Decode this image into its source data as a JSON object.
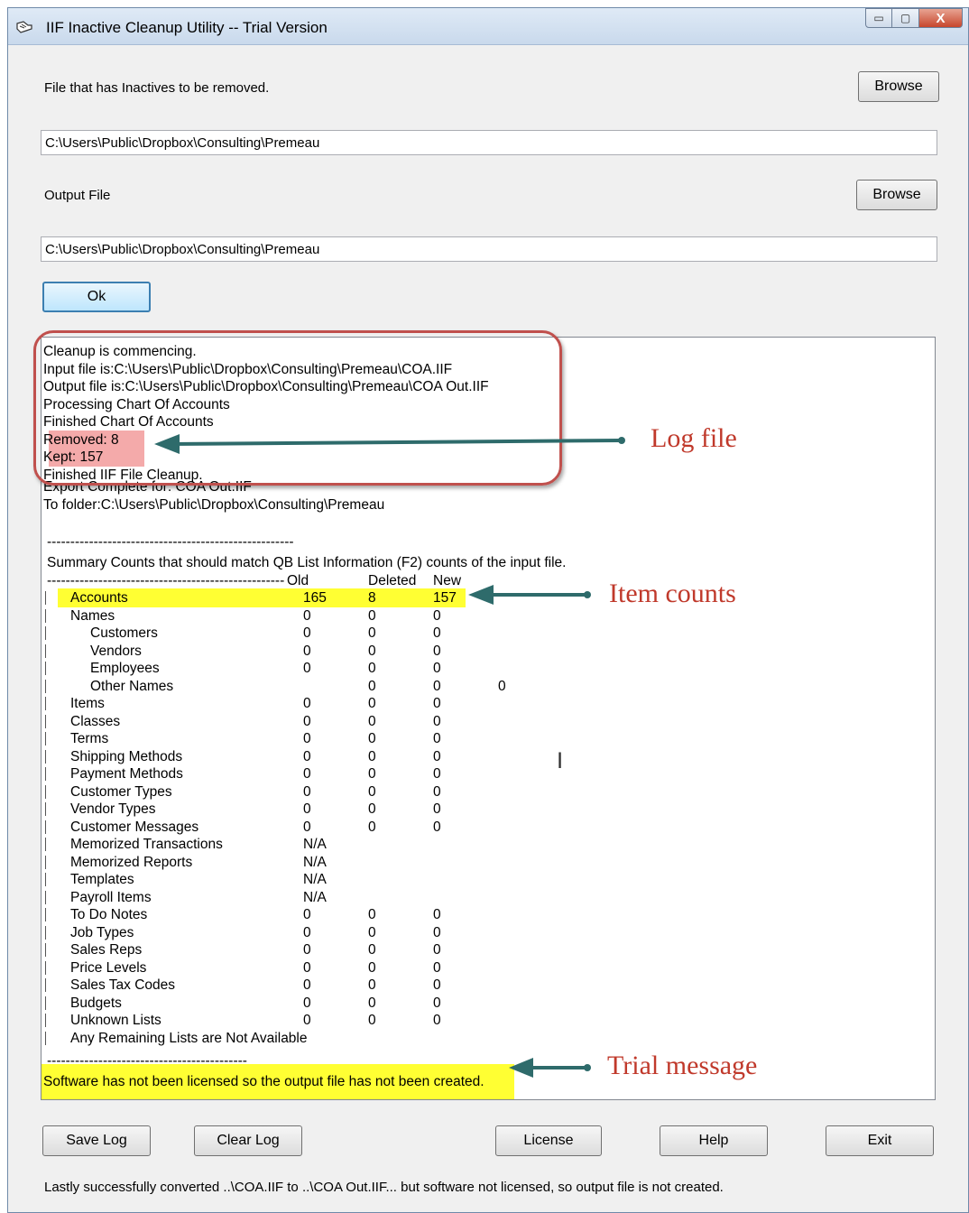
{
  "window": {
    "title": "IIF Inactive Cleanup Utility -- Trial Version",
    "controls": {
      "minimize": "▭",
      "maximize": "▢",
      "close": "X"
    }
  },
  "input": {
    "label": "File that has Inactives to be removed.",
    "browse": "Browse",
    "path": "C:\\Users\\Public\\Dropbox\\Consulting\\Premeau"
  },
  "output": {
    "label": "Output File",
    "browse": "Browse",
    "path": "C:\\Users\\Public\\Dropbox\\Consulting\\Premeau"
  },
  "ok_button": "Ok",
  "log": {
    "header_lines": [
      "Cleanup is commencing.",
      " Input file is:C:\\Users\\Public\\Dropbox\\Consulting\\Premeau\\COA.IIF",
      " Output file is:C:\\Users\\Public\\Dropbox\\Consulting\\Premeau\\COA Out.IIF",
      "Processing Chart Of Accounts",
      "Finished Chart Of Accounts",
      "  Removed: 8",
      "    Kept: 157",
      "Finished IIF File Cleanup.",
      "  Export Complete for: COA Out.IIF",
      "  To folder:C:\\Users\\Public\\Dropbox\\Consulting\\Premeau"
    ],
    "separator_1": "-----------------------------------------------------",
    "summary_title": "Summary Counts that should match QB List Information (F2) counts of the input file.",
    "col_header": {
      "dashes": "---------------------------------------------------",
      "old": "Old",
      "deleted": "Deleted",
      "new": "New"
    },
    "rows": [
      {
        "name": "Accounts",
        "old": "165",
        "deleted": "8",
        "new": "157"
      },
      {
        "name": "Names",
        "old": "0",
        "deleted": "0",
        "new": "0"
      },
      {
        "name": "Customers",
        "old": "0",
        "deleted": "0",
        "new": "0"
      },
      {
        "name": "Vendors",
        "old": "0",
        "deleted": "0",
        "new": "0"
      },
      {
        "name": "Employees",
        "old": "0",
        "deleted": "0",
        "new": "0"
      },
      {
        "name": "Other Names",
        "old": "",
        "deleted": "0",
        "new": "0",
        "extra": "0"
      },
      {
        "name": "Items",
        "old": "0",
        "deleted": "0",
        "new": "0"
      },
      {
        "name": "Classes",
        "old": "0",
        "deleted": "0",
        "new": "0"
      },
      {
        "name": "Terms",
        "old": "0",
        "deleted": "0",
        "new": "0"
      },
      {
        "name": "Shipping Methods",
        "old": "0",
        "deleted": "0",
        "new": "0"
      },
      {
        "name": "Payment Methods",
        "old": "0",
        "deleted": "0",
        "new": "0"
      },
      {
        "name": "Customer Types",
        "old": "0",
        "deleted": "0",
        "new": "0"
      },
      {
        "name": "Vendor Types",
        "old": "0",
        "deleted": "0",
        "new": "0"
      },
      {
        "name": "Customer Messages",
        "old": "0",
        "deleted": "0",
        "new": "0"
      },
      {
        "name": "Memorized Transactions",
        "old": "N/A",
        "deleted": "",
        "new": ""
      },
      {
        "name": "Memorized Reports",
        "old": "N/A",
        "deleted": "",
        "new": ""
      },
      {
        "name": "Templates",
        "old": "N/A",
        "deleted": "",
        "new": ""
      },
      {
        "name": "Payroll Items",
        "old": "N/A",
        "deleted": "",
        "new": ""
      },
      {
        "name": "To Do Notes",
        "old": "0",
        "deleted": "0",
        "new": "0"
      },
      {
        "name": "Job Types",
        "old": "0",
        "deleted": "0",
        "new": "0"
      },
      {
        "name": "Sales Reps",
        "old": "0",
        "deleted": "0",
        "new": "0"
      },
      {
        "name": "Price Levels",
        "old": "0",
        "deleted": "0",
        "new": "0"
      },
      {
        "name": "Sales Tax Codes",
        "old": "0",
        "deleted": "0",
        "new": "0"
      },
      {
        "name": "Budgets",
        "old": "0",
        "deleted": "0",
        "new": "0"
      },
      {
        "name": "Unknown Lists",
        "old": "0",
        "deleted": "0",
        "new": "0"
      },
      {
        "name": "Any Remaining Lists are Not Available",
        "old": "",
        "deleted": "",
        "new": ""
      }
    ],
    "separator_2": "-------------------------------------------",
    "trial_message": "Software has not been licensed so the output file has not been created."
  },
  "annotations": {
    "log_file": "Log file",
    "item_counts": "Item counts",
    "trial_message": "Trial message",
    "color": "#c0392b",
    "arrow_color": "#2e6b6b"
  },
  "buttons": {
    "save_log": "Save Log",
    "clear_log": "Clear Log",
    "license": "License",
    "help": "Help",
    "exit": "Exit"
  },
  "status": "Lastly successfully converted ..\\COA.IIF to ..\\COA Out.IIF... but software not licensed, so output file is not created."
}
